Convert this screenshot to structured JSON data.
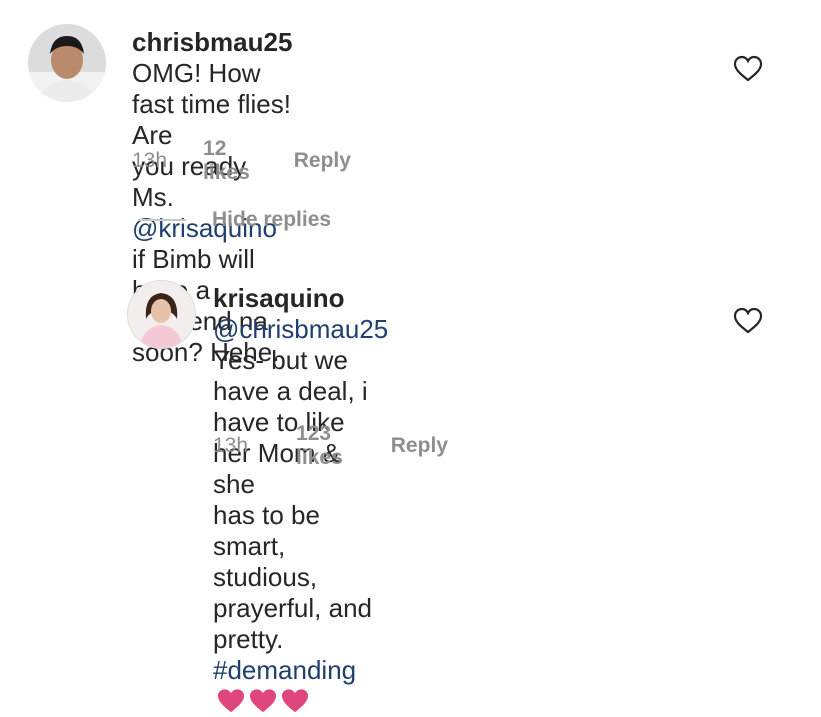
{
  "comment1": {
    "username": "chrisbmau25",
    "text_line1": "OMG! How fast time flies! Are",
    "text_line2_pre": "you ready Ms. ",
    "mention": "@krisaquino",
    "text_line2_post": " if Bimb will have a",
    "text_line3": "girlfriend na soon? Hehe.",
    "time": "13h",
    "likes": "12 likes",
    "reply": "Reply"
  },
  "hide_replies": "Hide replies",
  "comment2": {
    "username": "krisaquino",
    "mention": "@chrisbmau25",
    "text_line1_post": " Yes- but we",
    "text_line2": "have a deal, i have to like her Mom & she",
    "text_line3": "has to be smart, studious, prayerful, and",
    "text_line4_pre": "pretty. ",
    "hashtag": "#demanding",
    "emoji": [
      "pink-heart-icon",
      "pink-heart-icon",
      "pink-heart-icon"
    ],
    "time": "13h",
    "likes": "123 likes",
    "reply": "Reply"
  },
  "colors": {
    "link": "#1f3f6e",
    "meta": "#8e8e8e",
    "emoji_heart": "#e0457b"
  }
}
